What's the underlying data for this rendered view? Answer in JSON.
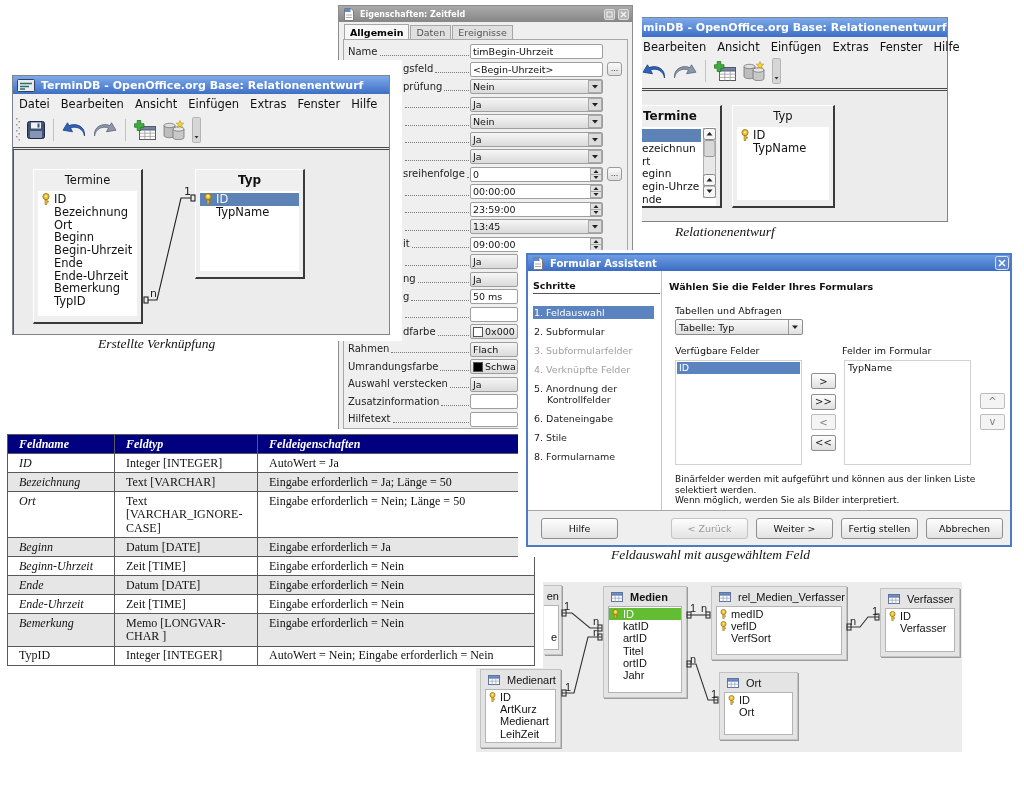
{
  "properties_dialog": {
    "title": "Eigenschaften: Zeitfeld",
    "tabs": [
      {
        "label": "Allgemein",
        "selected": true
      },
      {
        "label": "Daten",
        "selected": false
      },
      {
        "label": "Ereignisse",
        "selected": false
      }
    ],
    "rows": [
      {
        "label": "Name",
        "kind": "text",
        "value": "timBegin-Uhrzeit"
      },
      {
        "label": "gsfeld",
        "kind": "text",
        "value": "<Begin-Uhrzeit>",
        "button": "..."
      },
      {
        "label": "prüfung",
        "kind": "list",
        "value": "Nein"
      },
      {
        "kind": "list",
        "value": "Ja"
      },
      {
        "kind": "list",
        "value": "Nein"
      },
      {
        "kind": "list",
        "value": "Ja"
      },
      {
        "kind": "list",
        "value": "Ja"
      },
      {
        "label": "sreihenfolge",
        "kind": "spin",
        "value": "0",
        "button": "..."
      },
      {
        "kind": "spin",
        "value": "00:00:00"
      },
      {
        "kind": "spin",
        "value": "23:59:00"
      },
      {
        "kind": "list",
        "value": "13:45"
      },
      {
        "label": "it",
        "kind": "spin",
        "value": "09:00:00"
      },
      {
        "kind": "list",
        "value": "Ja"
      },
      {
        "label": "ng",
        "kind": "list",
        "value": "Ja"
      },
      {
        "label": "g",
        "kind": "text",
        "value": "50 ms"
      },
      {
        "kind": "text"
      },
      {
        "label": "dfarbe",
        "kind": "color",
        "value": "0x000",
        "color": "#ffffff"
      },
      {
        "label": "Rahmen",
        "kind": "list",
        "value": "Flach"
      },
      {
        "label": "Umrandungsfarbe",
        "kind": "color",
        "value": "Schwa",
        "color": "#000000"
      },
      {
        "label": "Auswahl verstecken",
        "kind": "list",
        "value": "Ja"
      },
      {
        "label": "Zusatzinformation",
        "kind": "text"
      },
      {
        "label": "Hilfetext",
        "kind": "text"
      }
    ]
  },
  "relation_window": {
    "title": "TerminDB - OpenOffice.org Base: Relationenentwurf",
    "menu": [
      "Datei",
      "Bearbeiten",
      "Ansicht",
      "Einfügen",
      "Extras",
      "Fenster",
      "Hilfe"
    ],
    "tables": [
      {
        "title": "Termine",
        "active": false,
        "fields": [
          {
            "name": "ID",
            "key": true,
            "selected": false
          },
          {
            "name": "Bezeichnung",
            "key": false,
            "selected": false
          },
          {
            "name": "Ort",
            "key": false,
            "selected": false
          },
          {
            "name": "Beginn",
            "key": false,
            "selected": false
          },
          {
            "name": "Begin-Uhrzeit",
            "key": false,
            "selected": false
          },
          {
            "name": "Ende",
            "key": false,
            "selected": false
          },
          {
            "name": "Ende-Uhrzeit",
            "key": false,
            "selected": false
          },
          {
            "name": "Bemerkung",
            "key": false,
            "selected": false
          },
          {
            "name": "TypID",
            "key": false,
            "selected": false
          }
        ]
      },
      {
        "title": "Typ",
        "active": true,
        "fields": [
          {
            "name": "ID",
            "key": true,
            "selected": true
          },
          {
            "name": "TypName",
            "key": false,
            "selected": false
          }
        ]
      }
    ],
    "relations": [
      {
        "from_label": "n",
        "to_label": "1"
      }
    ],
    "caption": "Erstellte Verknüpfung"
  },
  "relation_window_cropped": {
    "title": "minDB - OpenOffice.org Base: Relationenentwurf",
    "menu": [
      "Bearbeiten",
      "Ansicht",
      "Einfügen",
      "Extras",
      "Fenster",
      "Hilfe"
    ],
    "tables": [
      {
        "title": "Termine",
        "active": true,
        "fields": [
          {
            "key": false,
            "selected": true
          },
          {
            "name": "ezeichnun",
            "key": false,
            "selected": false
          },
          {
            "name": "rt",
            "key": false,
            "selected": false
          },
          {
            "name": "eginn",
            "key": false,
            "selected": false
          },
          {
            "name": "egin-Uhrze",
            "key": false,
            "selected": false
          },
          {
            "name": "nde",
            "key": false,
            "selected": false
          }
        ]
      },
      {
        "title": "Typ",
        "active": false,
        "fields": [
          {
            "name": "ID",
            "key": true,
            "selected": false
          },
          {
            "name": "TypName",
            "key": false,
            "selected": false
          }
        ]
      }
    ],
    "caption": "Relationenentwurf"
  },
  "form_wizard": {
    "title": "Formular Assistent",
    "steps_heading": "Schritte",
    "steps": [
      {
        "label": "1. Feldauswahl",
        "selected": true,
        "disabled": false
      },
      {
        "label": "2. Subformular",
        "selected": false,
        "disabled": false
      },
      {
        "label": "3. Subformularfelder",
        "selected": false,
        "disabled": true
      },
      {
        "label": "4. Verknüpfte Felder",
        "selected": false,
        "disabled": true
      },
      {
        "label": "5. Anordnung der Kontrollfelder",
        "selected": false,
        "disabled": false
      },
      {
        "label": "6. Dateneingabe",
        "selected": false,
        "disabled": false
      },
      {
        "label": "7. Stile",
        "selected": false,
        "disabled": false
      },
      {
        "label": "8. Formularname",
        "selected": false,
        "disabled": false
      }
    ],
    "heading": "Wählen Sie die Felder Ihres Formulars",
    "source_label": "Tabellen und Abfragen",
    "source_value": "Tabelle: Typ",
    "available_label": "Verfügbare Felder",
    "available_fields": [
      {
        "label": "ID",
        "selected": true
      }
    ],
    "form_label": "Felder im Formular",
    "form_fields": [
      {
        "label": "TypName",
        "selected": false
      }
    ],
    "move_buttons": [
      {
        "label": ">",
        "disabled": false
      },
      {
        "label": ">>",
        "disabled": false
      },
      {
        "label": "<",
        "disabled": true
      },
      {
        "label": "<<",
        "disabled": false
      }
    ],
    "order_buttons": [
      {
        "label": "^",
        "disabled": true
      },
      {
        "label": "v",
        "disabled": true
      }
    ],
    "note": [
      "Binärfelder werden mit aufgeführt und können aus der linken Liste selektiert werden.",
      "Wenn möglich, werden Sie als Bilder interpretiert."
    ],
    "buttons": [
      {
        "label": "Hilfe",
        "disabled": false
      },
      {
        "label": "< Zurück",
        "disabled": true
      },
      {
        "label": "Weiter >",
        "disabled": false
      },
      {
        "label": "Fertig stellen",
        "disabled": false
      },
      {
        "label": "Abbrechen",
        "disabled": false
      }
    ],
    "caption": "Feldauswahl mit ausgewähltem Feld"
  },
  "field_table": {
    "columns": [
      "Feldname",
      "Feldtyp",
      "Feldeigenschaften"
    ],
    "rows": [
      {
        "italic": true,
        "cells": [
          "ID",
          "Integer [INTEGER]",
          "AutoWert = Ja"
        ]
      },
      {
        "italic": true,
        "cells": [
          "Bezeichnung",
          "Text [VARCHAR]",
          "Eingabe erforderlich = Ja; Länge = 50"
        ]
      },
      {
        "italic": true,
        "cells": [
          "Ort",
          "Text [VARCHAR_IGNORE-CASE]",
          "Eingabe erforderlich = Nein; Länge = 50"
        ]
      },
      {
        "italic": true,
        "cells": [
          "Beginn",
          "Datum [DATE]",
          "Eingabe erforderlich = Ja"
        ]
      },
      {
        "italic": true,
        "cells": [
          "Beginn-Uhrzeit",
          "Zeit [TIME]",
          "Eingabe erforderlich = Nein"
        ]
      },
      {
        "italic": true,
        "cells": [
          "Ende",
          "Datum [DATE]",
          "Eingabe erforderlich = Nein"
        ]
      },
      {
        "italic": true,
        "cells": [
          "Ende-Uhrzeit",
          "Zeit [TIME]",
          "Eingabe erforderlich = Nein"
        ]
      },
      {
        "italic": true,
        "cells": [
          "Bemerkung",
          "Memo [LONGVAR-CHAR ]",
          "Eingabe erforderlich = Nein"
        ]
      },
      {
        "italic": false,
        "cells": [
          "TypID",
          "Integer [INTEGER]",
          "AutoWert = Nein; Eingabe erforderlich = Nein"
        ]
      }
    ]
  },
  "media_diagram": {
    "tables": [
      {
        "kind": "cut",
        "title": "en",
        "active": false,
        "fields": [
          {
            "name": "e",
            "key": false,
            "selected": false
          }
        ]
      },
      {
        "kind": "table",
        "title": "Medien",
        "active": true,
        "fields": [
          {
            "name": "ID",
            "key": true,
            "selected": true
          },
          {
            "name": "katID",
            "key": false,
            "selected": false
          },
          {
            "name": "artID",
            "key": false,
            "selected": false
          },
          {
            "name": "Titel",
            "key": false,
            "selected": false
          },
          {
            "name": "ortID",
            "key": false,
            "selected": false
          },
          {
            "name": "Jahr",
            "key": false,
            "selected": false
          }
        ]
      },
      {
        "kind": "table",
        "title": "rel_Medien_Verfasser",
        "active": false,
        "fields": [
          {
            "name": "medID",
            "key": true,
            "selected": false
          },
          {
            "name": "vefID",
            "key": true,
            "selected": false
          },
          {
            "name": "VerfSort",
            "key": false,
            "selected": false
          }
        ]
      },
      {
        "kind": "table",
        "title": "Verfasser",
        "active": false,
        "fields": [
          {
            "name": "ID",
            "key": true,
            "selected": false
          },
          {
            "name": "Verfasser",
            "key": false,
            "selected": false
          }
        ]
      },
      {
        "kind": "table",
        "title": "Medienart",
        "active": false,
        "fields": [
          {
            "name": "ID",
            "key": true,
            "selected": false
          },
          {
            "name": "ArtKurz",
            "key": false,
            "selected": false
          },
          {
            "name": "Medienart",
            "key": false,
            "selected": false
          },
          {
            "name": "LeihZeit",
            "key": false,
            "selected": false
          }
        ]
      },
      {
        "kind": "table",
        "title": "Ort",
        "active": false,
        "fields": [
          {
            "name": "ID",
            "key": true,
            "selected": false
          },
          {
            "name": "Ort",
            "key": false,
            "selected": false
          }
        ]
      }
    ],
    "relations": [
      {
        "from_label": "1",
        "to_label": "n"
      },
      {
        "from_label": "1",
        "to_label": "n"
      },
      {
        "from_label": "1",
        "to_label": "n"
      },
      {
        "from_label": "n",
        "to_label": "1"
      },
      {
        "from_label": "n",
        "to_label": "1"
      }
    ]
  }
}
